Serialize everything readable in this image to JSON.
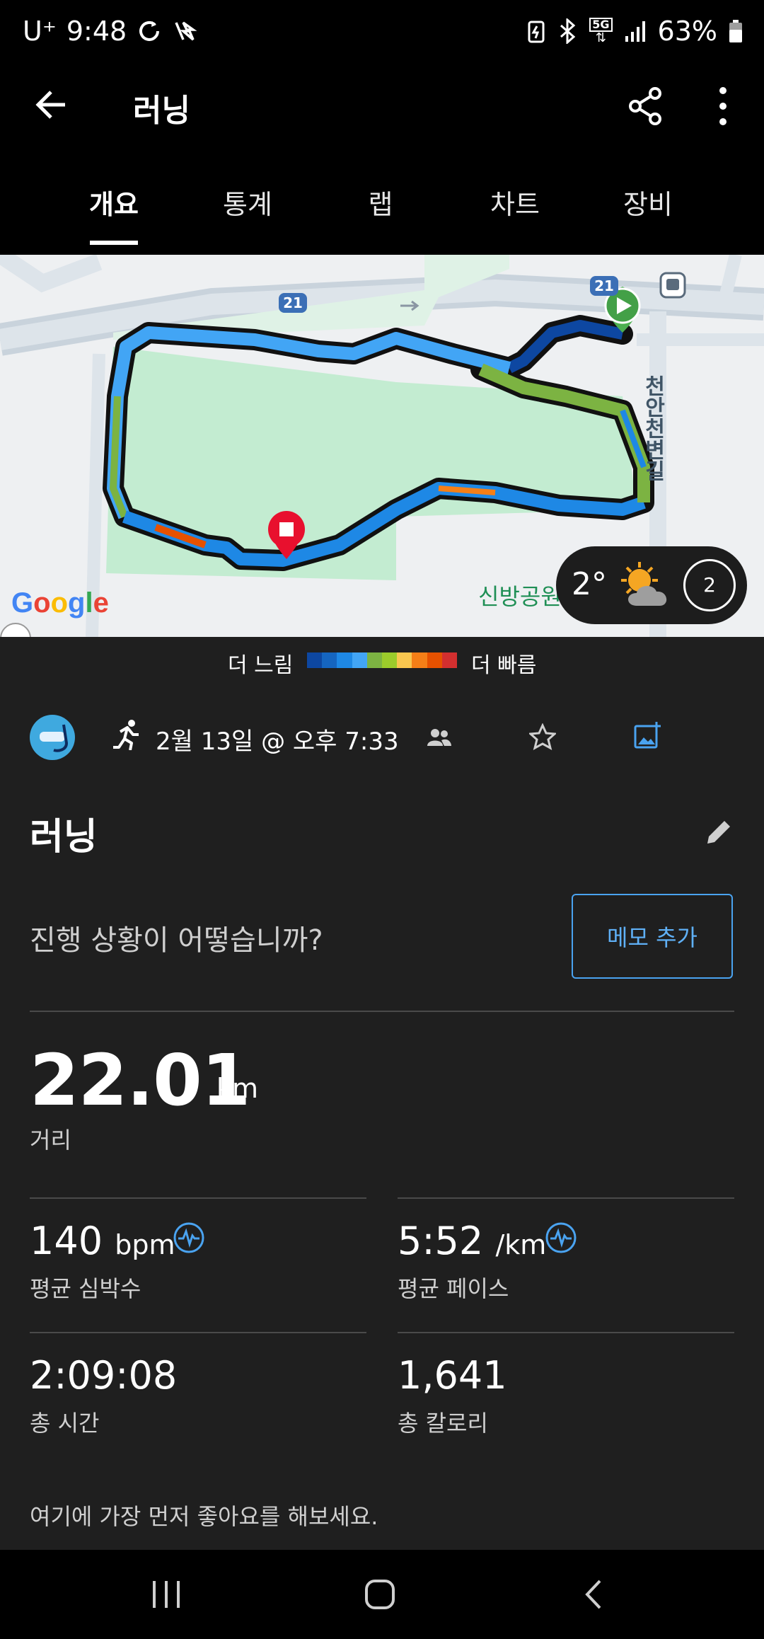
{
  "status": {
    "carrier": "U⁺",
    "time": "9:48",
    "network": "5G",
    "battery": "63%"
  },
  "appbar": {
    "title": "러닝",
    "back_icon": "arrow-left-icon",
    "share_icon": "share-icon",
    "more_icon": "more-vertical-icon"
  },
  "tabs": [
    "개요",
    "통계",
    "랩",
    "차트",
    "장비"
  ],
  "active_tab": 0,
  "map": {
    "road_label": "21",
    "road_label2": "21",
    "street_label": "천안천변길",
    "park_label": "신방공원",
    "google": [
      "G",
      "o",
      "o",
      "g",
      "l",
      "e"
    ],
    "weather_temp": "2°",
    "weather_count": "2"
  },
  "legend": {
    "slow": "더 느림",
    "fast": "더 빠름",
    "colors": [
      "#0d47a1",
      "#1565c0",
      "#1e88e5",
      "#42a5f5",
      "#7cb342",
      "#9ccc2b",
      "#f9c74f",
      "#f57f17",
      "#e65100",
      "#d32f2f"
    ]
  },
  "info": {
    "datetime": "2월 13일 @ 오후 7:33"
  },
  "activity": {
    "title": "러닝",
    "prompt": "진행 상황이 어떻습니까?",
    "memo_button": "메모 추가"
  },
  "stats": {
    "distance_value": "22.01",
    "distance_unit": "km",
    "distance_label": "거리",
    "hr_value": "140",
    "hr_unit": "bpm",
    "hr_label": "평균 심박수",
    "pace_value": "5:52",
    "pace_unit": "/km",
    "pace_label": "평균 페이스",
    "time_value": "2:09:08",
    "time_label": "총 시간",
    "cal_value": "1,641",
    "cal_label": "총 칼로리"
  },
  "like_note": "여기에 가장 먼저 좋아요를 해보세요."
}
